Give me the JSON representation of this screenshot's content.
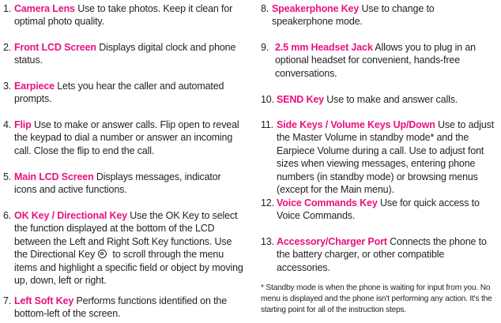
{
  "left_items": [
    {
      "num": "1.",
      "term": "Camera Lens",
      "text": " Use to take photos. Keep it clean for optimal photo quality."
    },
    {
      "num": "2.",
      "term": "Front LCD Screen",
      "text": " Displays digital clock and phone status."
    },
    {
      "num": "3.",
      "term": "Earpiece",
      "text": " Lets you hear the caller and automated prompts."
    },
    {
      "num": "4.",
      "term": "Flip",
      "text": " Use to make or answer calls. Flip open to reveal the keypad to dial a number or answer an incoming call. Close the flip to end the call."
    },
    {
      "num": "5.",
      "term": "Main LCD Screen",
      "text": " Displays messages, indicator icons and active functions."
    },
    {
      "num": "6.",
      "term": "OK Key / Directional Key",
      "text": " Use the OK Key to select the function displayed at the bottom of the LCD between the Left and Right Soft Key functions. Use the Directional Key",
      "text_after_icon": " to scroll through the menu items and highlight a specific field or object by moving up, down, left or right."
    },
    {
      "num": "7.",
      "term": "Left Soft Key",
      "text": " Performs functions identified on the bottom-left of the screen."
    }
  ],
  "right_items": [
    {
      "num": "8.",
      "term": "Speakerphone Key",
      "text": " Use to change to speakerphone mode."
    },
    {
      "num": "9.",
      "term": "2.5 mm Headset Jack",
      "text": " Allows you to plug in an optional headset for convenient, hands-free conversations."
    },
    {
      "num": "10.",
      "term": "SEND Key",
      "text": " Use to make and answer calls."
    },
    {
      "num": "11.",
      "term": "Side Keys / Volume Keys Up/Down",
      "text": " Use to adjust the Master Volume in standby mode* and the Earpiece Volume during a call. Use to adjust font sizes when viewing messages, entering phone numbers (in standby mode) or browsing menus (except for the Main menu)."
    },
    {
      "num": "12.",
      "term": "Voice Commands Key",
      "text": " Use for quick access to Voice Commands."
    },
    {
      "num": "13.",
      "term": "Accessory/Charger Port",
      "text": " Connects the phone to the battery charger, or other compatible accessories."
    }
  ],
  "footnote": "* Standby mode is when the phone is waiting for input from you. No menu is displayed and the phone isn't performing any action. It's the starting point for all of the instruction steps.",
  "colors": {
    "term": "#e8117f",
    "text": "#231f20"
  },
  "icons": {
    "directional_key": "directional-key-icon"
  }
}
